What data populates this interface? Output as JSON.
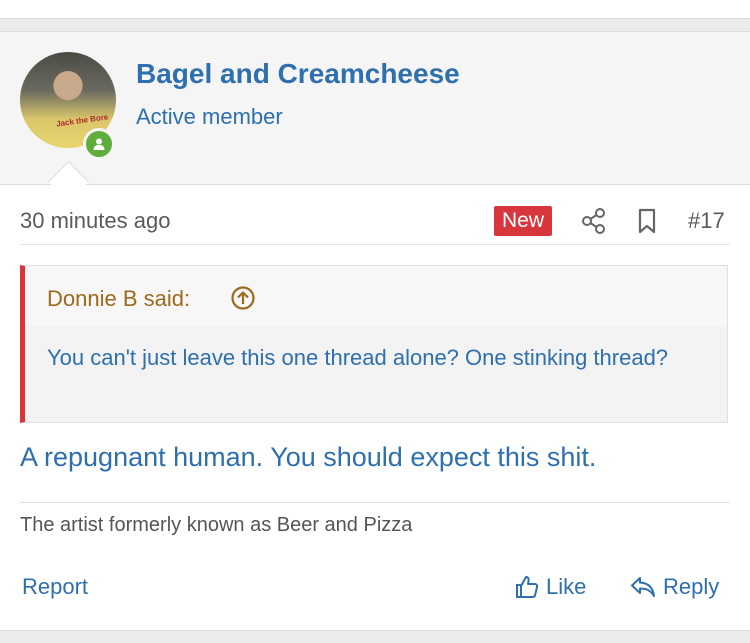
{
  "user": {
    "name": "Bagel and Creamcheese",
    "title": "Active member",
    "avatar_text": "Jack the Bore",
    "status": "online"
  },
  "post": {
    "time": "30 minutes ago",
    "badge": "New",
    "number": "#17",
    "quote": {
      "author": "Donnie B said:",
      "text": "You can't just leave this one thread alone? One stinking thread?"
    },
    "body": "A repugnant human. You should expect this shit.",
    "signature": "The artist formerly known as Beer and Pizza"
  },
  "actions": {
    "report": "Report",
    "like": "Like",
    "reply": "Reply"
  },
  "colors": {
    "link": "#2e6fae",
    "badge": "#d9353d",
    "quote_author": "#9c6a1c",
    "online": "#5fae3b"
  }
}
